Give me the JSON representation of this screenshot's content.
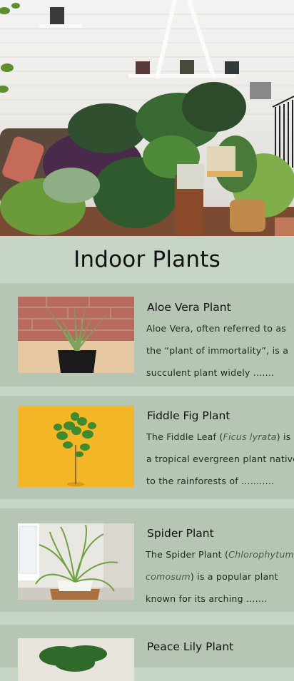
{
  "page": {
    "title": "Indoor Plants",
    "colors": {
      "background": "#c7d5c6",
      "card": "#b7c6b4"
    }
  },
  "hero": {
    "image": "plants-banner-icon"
  },
  "plants": [
    {
      "name": "Aloe Vera Plant",
      "image": "aloe-vera-photo",
      "desc_line1": "Aloe Vera, often referred to as",
      "desc_line2": "the “plant of immortality”, is a",
      "desc_line3": "succulent plant widely .......",
      "desc_line3b": ""
    },
    {
      "name": "Fiddle Fig Plant",
      "image": "fiddle-fig-photo",
      "desc_pre": "The Fiddle Leaf (",
      "desc_italic": "Ficus lyrata",
      "desc_post": ") is",
      "desc_line2": "a tropical evergreen plant native",
      "desc_line3": "to the rainforests of ..........."
    },
    {
      "name": "Spider Plant",
      "image": "spider-plant-photo",
      "desc_pre": "The Spider Plant (",
      "desc_italic": "Chlorophytum-",
      "desc_italic2": "comosum",
      "desc_post": ") is a popular plant",
      "desc_line3": "known for its arching ......."
    },
    {
      "name": "Peace Lily Plant",
      "image": "peace-lily-photo"
    }
  ]
}
